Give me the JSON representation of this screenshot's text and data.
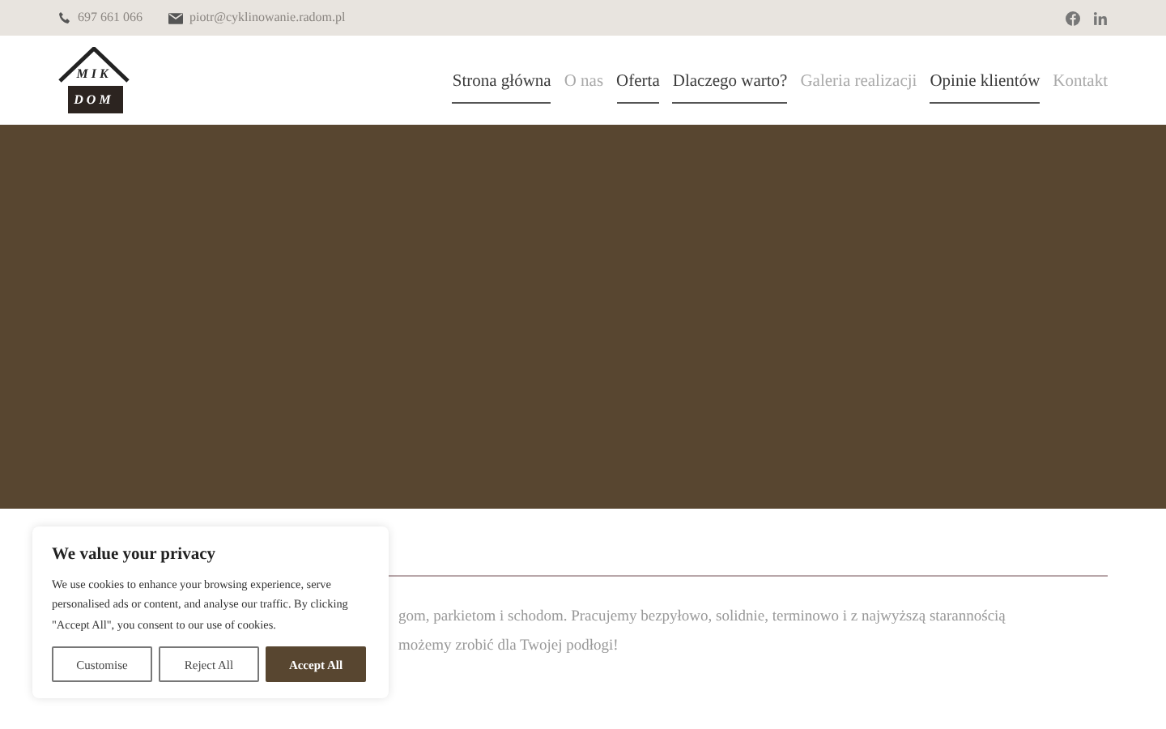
{
  "topbar": {
    "phone": "697 661 066",
    "email": "piotr@cyklinowanie.radom.pl"
  },
  "logo": {
    "line_1": "MIK",
    "line_2": "DOM"
  },
  "nav": [
    {
      "label": "Strona główna",
      "underlined": true
    },
    {
      "label": "O nas",
      "underlined": false
    },
    {
      "label": "Oferta",
      "underlined": true
    },
    {
      "label": "Dlaczego warto?",
      "underlined": true
    },
    {
      "label": "Galeria realizacji",
      "underlined": false
    },
    {
      "label": "Opinie klientów",
      "underlined": true
    },
    {
      "label": "Kontakt",
      "underlined": false
    }
  ],
  "content": {
    "lines": [
      "gom, parkietom i schodom. Pracujemy bezpyłowo, solidnie, terminowo i z najwyższą starannością",
      "możemy zrobić dla Twojej podłogi!"
    ]
  },
  "cookie_banner": {
    "title": "We value your privacy",
    "text": "We use cookies to enhance your browsing experience, serve personalised ads or content, and analyse our traffic. By clicking \"Accept All\", you consent to our use of cookies.",
    "buttons": [
      {
        "label": "Customise",
        "kind": "outline"
      },
      {
        "label": "Reject All",
        "kind": "outline"
      },
      {
        "label": "Accept All",
        "kind": "primary"
      }
    ]
  }
}
